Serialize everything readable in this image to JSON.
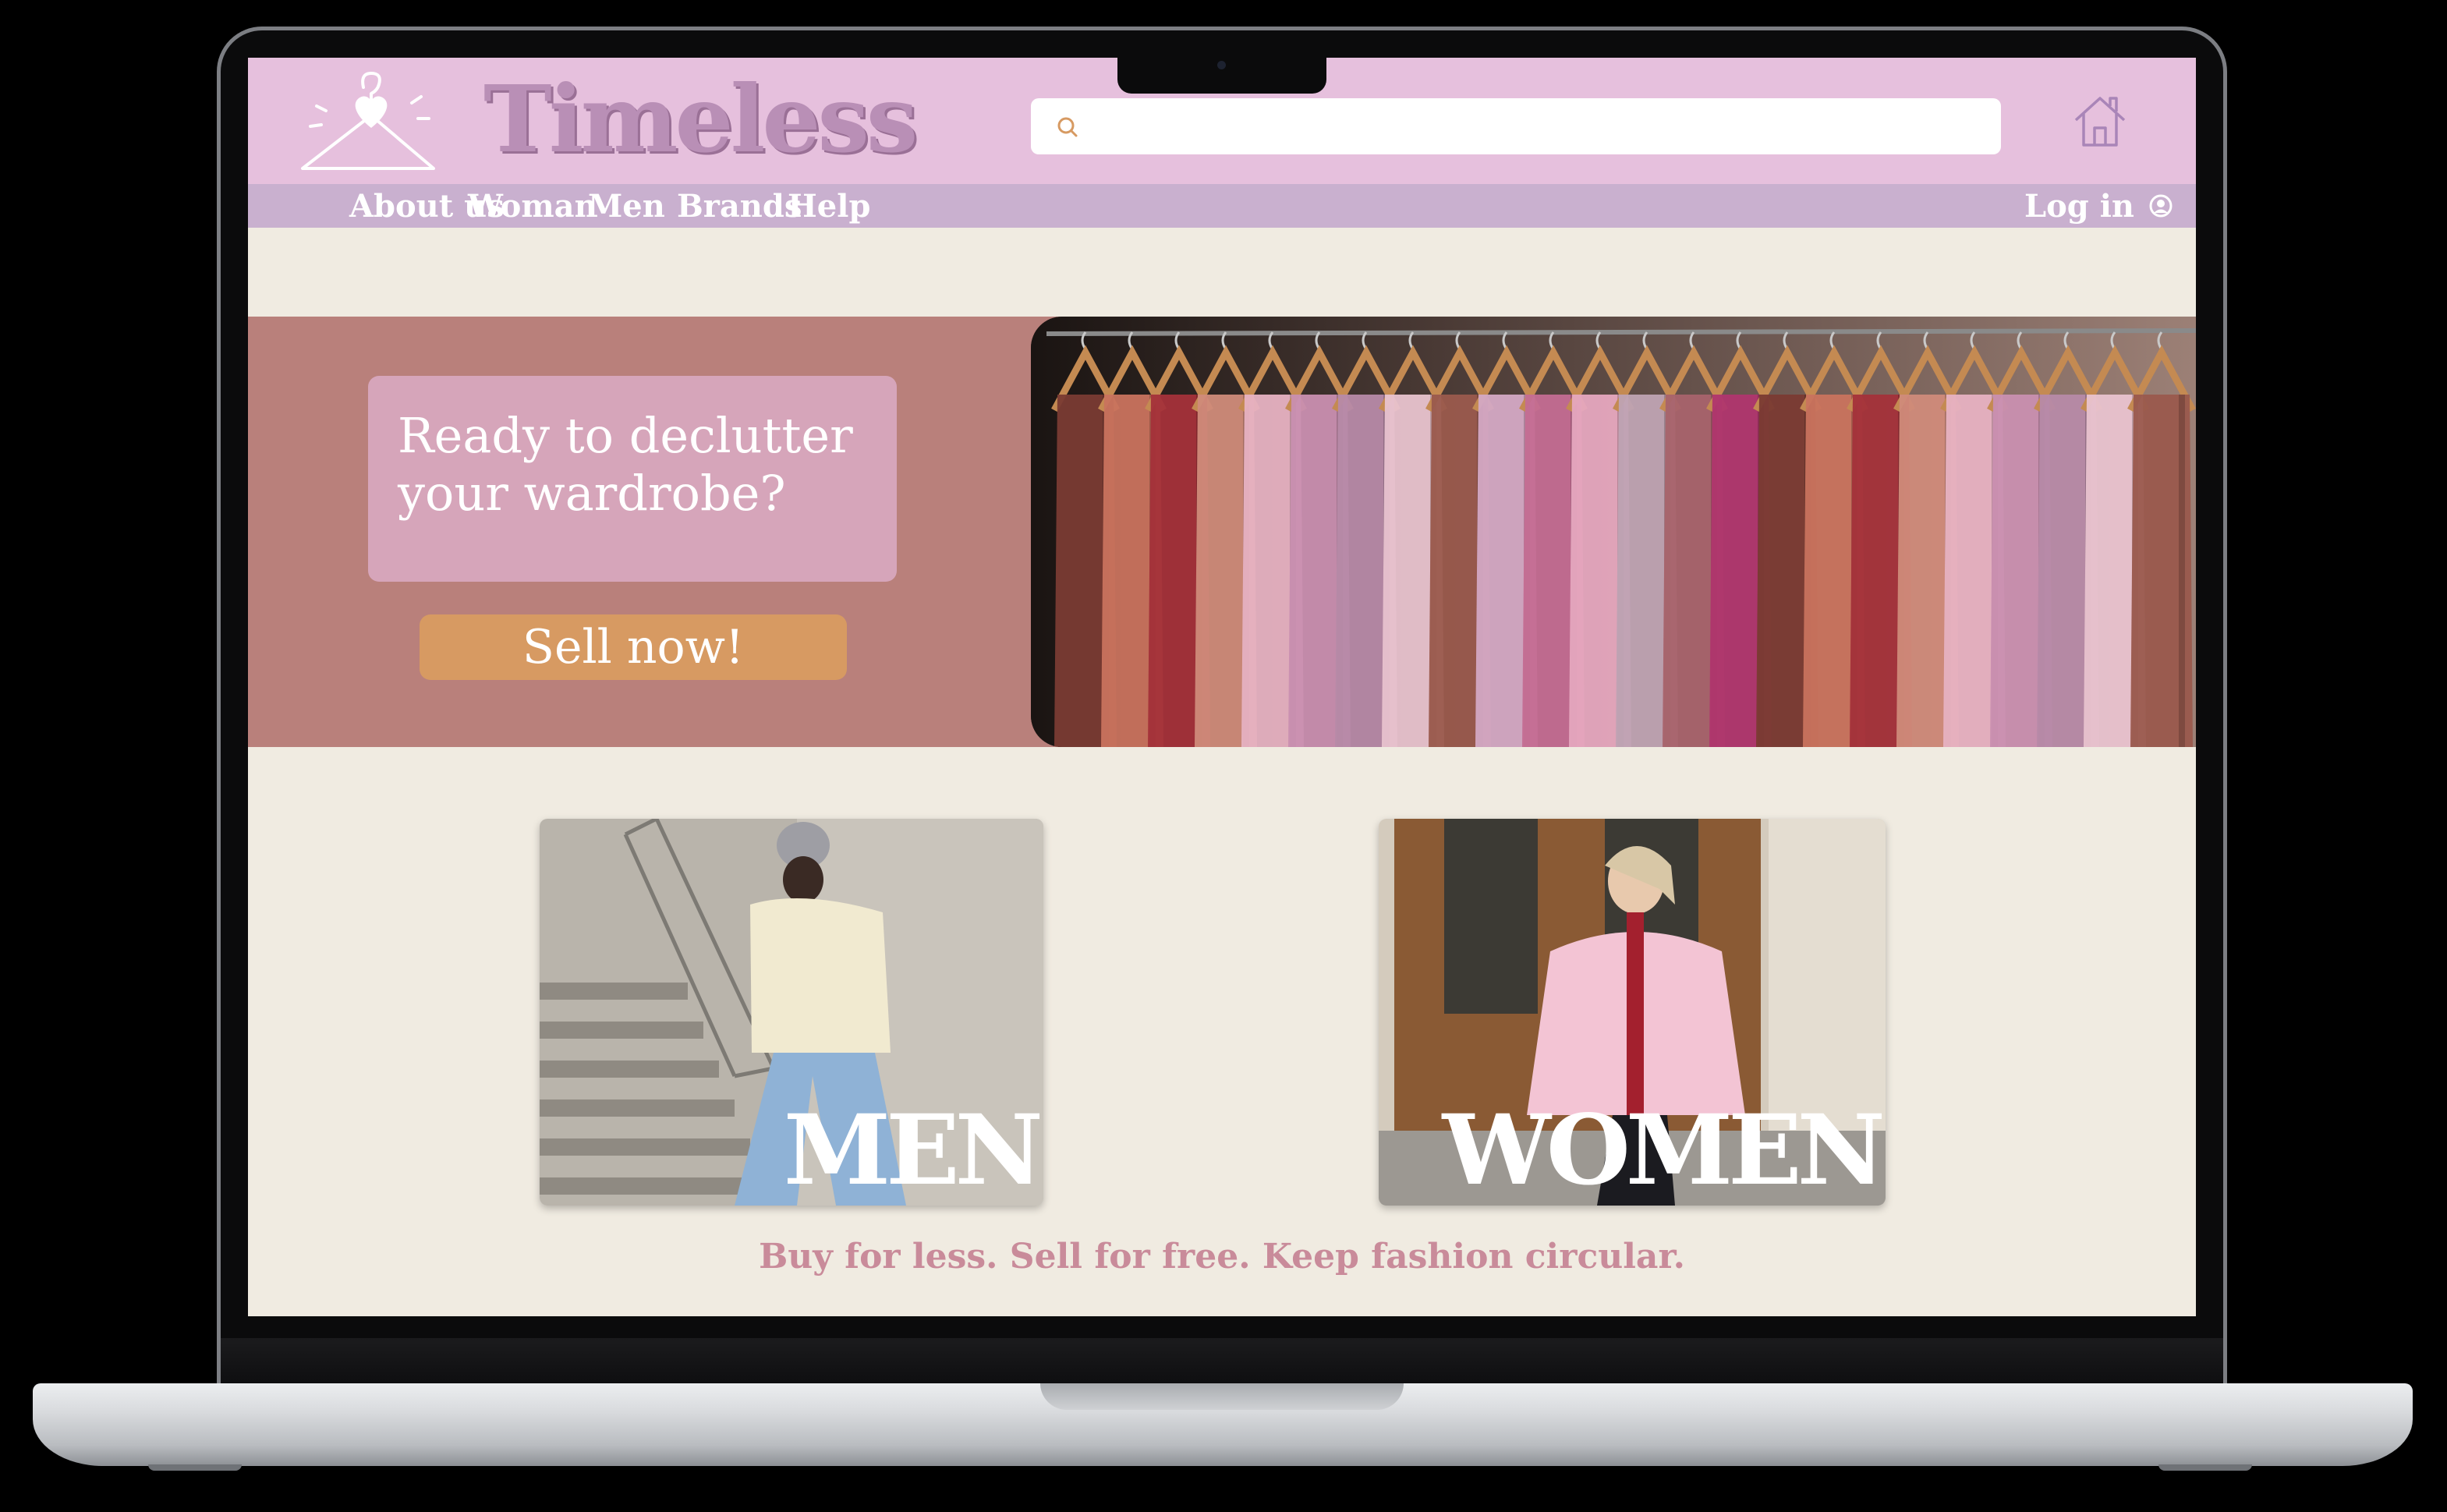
{
  "brand": {
    "name": "Timeless"
  },
  "search": {
    "value": "",
    "placeholder": ""
  },
  "nav": {
    "items": [
      "About us",
      "Woman",
      "Men",
      "Brands",
      "Help"
    ],
    "login_label": "Log in"
  },
  "hero": {
    "headline": "Ready to declutter your wardrobe?",
    "cta_label": "Sell now!"
  },
  "categories": [
    {
      "label": "MEN"
    },
    {
      "label": "WOMEN"
    }
  ],
  "tagline": "Buy for less. Sell for free. Keep fashion circular.",
  "colors": {
    "header": "#e6c0dd",
    "navbar": "#c9b0cf",
    "page_bg": "#f0ebe1",
    "hero_bg": "#b9807b",
    "hero_card": "#d6a5ba",
    "cta": "#d79a62",
    "tagline": "#c98b9a"
  },
  "icons": [
    "hanger-heart-icon",
    "search-icon",
    "home-icon",
    "user-circle-icon"
  ]
}
